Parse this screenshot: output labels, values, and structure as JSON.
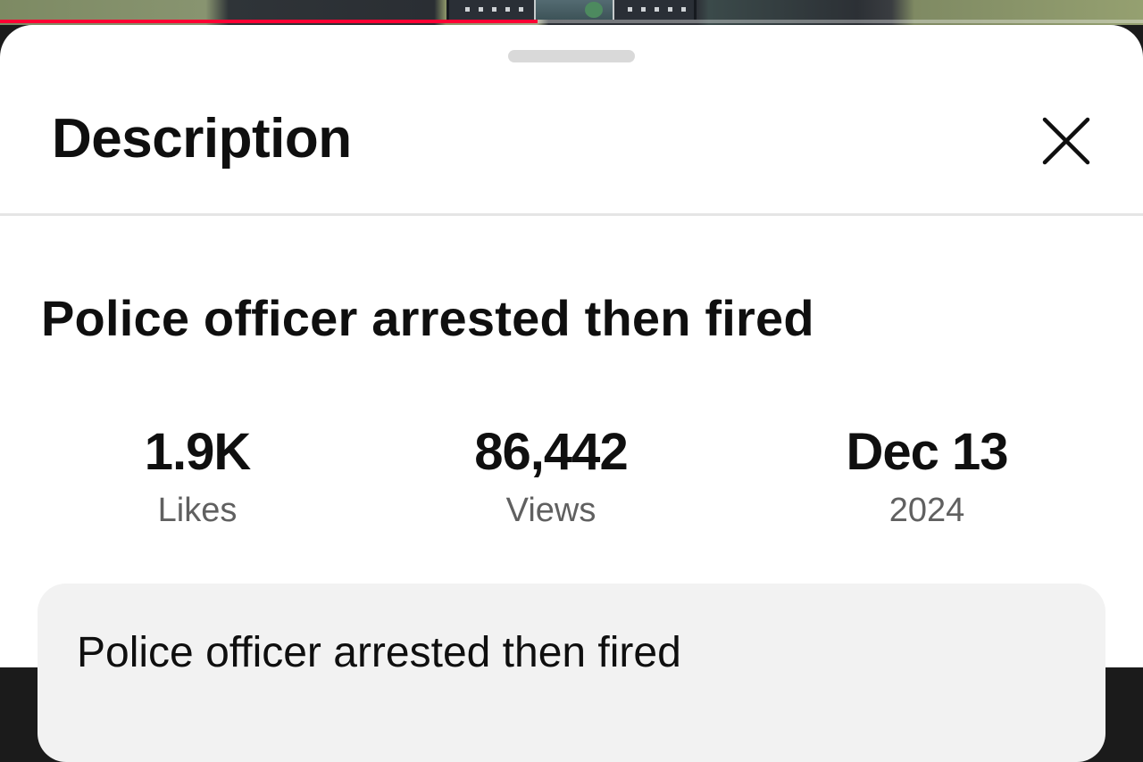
{
  "player": {
    "progress_fraction": 0.47,
    "progress_color": "#ff0033"
  },
  "sheet": {
    "title": "Description",
    "close_icon": "close-icon"
  },
  "video": {
    "title": "Police officer arrested then fired",
    "stats": {
      "likes_value": "1.9K",
      "likes_label": "Likes",
      "views_value": "86,442",
      "views_label": "Views",
      "date_value": "Dec 13",
      "date_year": "2024"
    },
    "description_text": "Police officer arrested then fired"
  }
}
